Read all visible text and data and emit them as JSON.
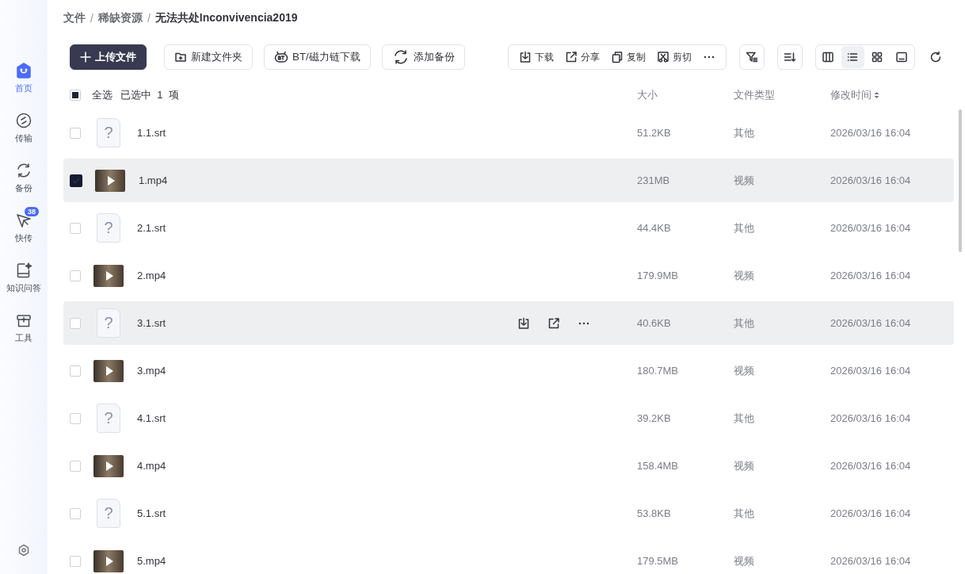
{
  "sidebar": {
    "items": [
      {
        "label": "首页",
        "kind": "home",
        "selected": true
      },
      {
        "label": "传输",
        "kind": "transfer",
        "selected": false
      },
      {
        "label": "备份",
        "kind": "backup",
        "selected": false
      },
      {
        "label": "快传",
        "kind": "send",
        "selected": false,
        "badge": "38"
      },
      {
        "label": "知识问答",
        "kind": "qa",
        "selected": false
      },
      {
        "label": "工具",
        "kind": "tools",
        "selected": false
      }
    ]
  },
  "breadcrumb_separator": "/",
  "breadcrumb": [
    {
      "label": "文件",
      "current": false
    },
    {
      "label": "稀缺资源",
      "current": false
    },
    {
      "label": "无法共处Inconvivencia2019",
      "current": true
    }
  ],
  "actions": [
    {
      "label": "上传文件",
      "kind": "upload",
      "primary": true
    },
    {
      "label": "新建文件夹",
      "kind": "folder",
      "primary": false
    },
    {
      "label": "BT/磁力链下载",
      "kind": "bt",
      "primary": false
    },
    {
      "label": "添加备份",
      "kind": "backup",
      "primary": false
    }
  ],
  "batch_actions": [
    {
      "label": "下载",
      "kind": "download"
    },
    {
      "label": "分享",
      "kind": "share"
    },
    {
      "label": "复制",
      "kind": "copy"
    },
    {
      "label": "剪切",
      "kind": "cut"
    },
    {
      "kind": "more"
    }
  ],
  "tools": [
    {
      "kind": "filter"
    },
    {
      "kind": "sort"
    }
  ],
  "view_modes": [
    {
      "kind": "columns",
      "selected": false
    },
    {
      "kind": "list",
      "selected": true
    },
    {
      "kind": "grid",
      "selected": false
    },
    {
      "kind": "preview",
      "selected": false
    }
  ],
  "select_all": {
    "label": "全选",
    "indeterminate": true,
    "selection_info": "已选中  1  项"
  },
  "columns": [
    {
      "label": "大小",
      "sorted": false
    },
    {
      "label": "文件类型",
      "sorted": false
    },
    {
      "label": "修改时间",
      "sorted": true
    }
  ],
  "rows": [
    {
      "name": "1.1.srt",
      "kind": "unknown",
      "glyph": "?",
      "size": "51.2KB",
      "type": "其他",
      "modified": "2026/03/16 16:04",
      "selected": false,
      "hovered": false
    },
    {
      "name": "1.mp4",
      "kind": "video",
      "size": "231MB",
      "type": "视频",
      "modified": "2026/03/16 16:04",
      "selected": true,
      "hovered": false
    },
    {
      "name": "2.1.srt",
      "kind": "unknown",
      "glyph": "?",
      "size": "44.4KB",
      "type": "其他",
      "modified": "2026/03/16 16:04",
      "selected": false,
      "hovered": false
    },
    {
      "name": "2.mp4",
      "kind": "video",
      "size": "179.9MB",
      "type": "视频",
      "modified": "2026/03/16 16:04",
      "selected": false,
      "hovered": false
    },
    {
      "name": "3.1.srt",
      "kind": "unknown",
      "glyph": "?",
      "size": "40.6KB",
      "type": "其他",
      "modified": "2026/03/16 16:04",
      "selected": false,
      "hovered": true
    },
    {
      "name": "3.mp4",
      "kind": "video",
      "size": "180.7MB",
      "type": "视频",
      "modified": "2026/03/16 16:04",
      "selected": false,
      "hovered": false
    },
    {
      "name": "4.1.srt",
      "kind": "unknown",
      "glyph": "?",
      "size": "39.2KB",
      "type": "其他",
      "modified": "2026/03/16 16:04",
      "selected": false,
      "hovered": false
    },
    {
      "name": "4.mp4",
      "kind": "video",
      "size": "158.4MB",
      "type": "视频",
      "modified": "2026/03/16 16:04",
      "selected": false,
      "hovered": false
    },
    {
      "name": "5.1.srt",
      "kind": "unknown",
      "glyph": "?",
      "size": "53.8KB",
      "type": "其他",
      "modified": "2026/03/16 16:04",
      "selected": false,
      "hovered": false
    },
    {
      "name": "5.mp4",
      "kind": "video",
      "size": "179.5MB",
      "type": "视频",
      "modified": "2026/03/16 16:04",
      "selected": false,
      "hovered": false
    }
  ]
}
